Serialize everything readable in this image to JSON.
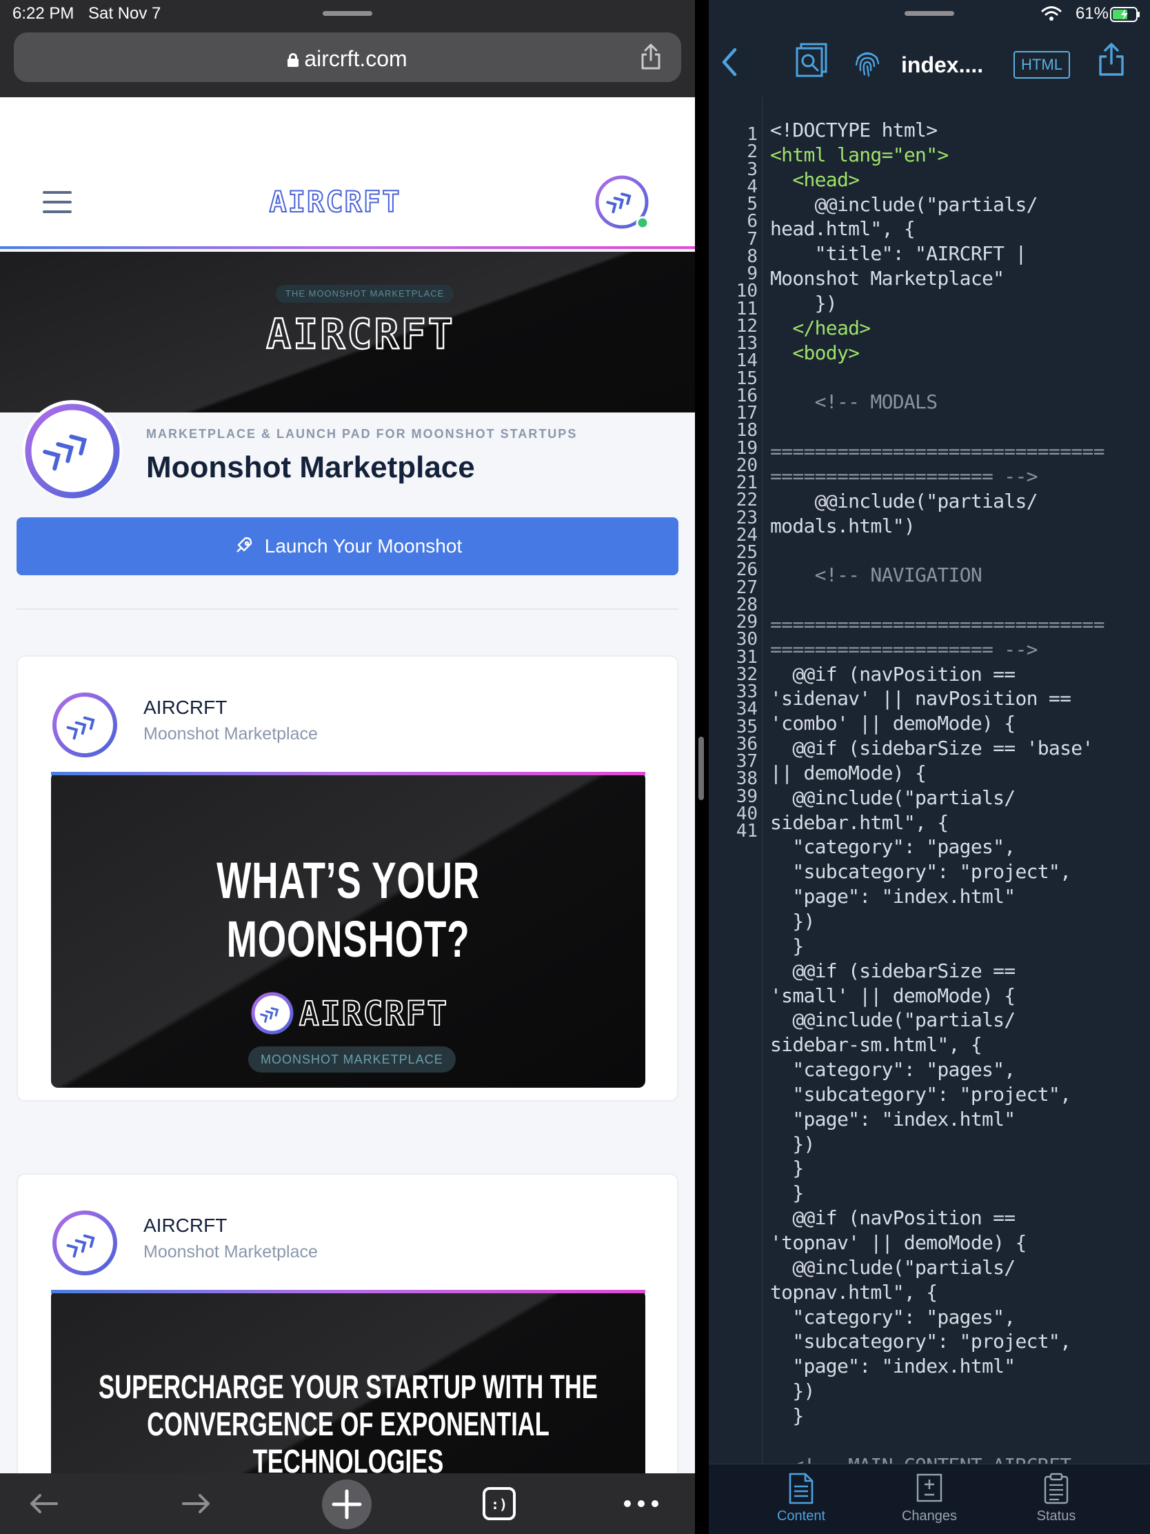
{
  "status_bar": {
    "time": "6:22 PM",
    "date": "Sat Nov 7",
    "battery": "61%"
  },
  "browser": {
    "url": "aircrft.com",
    "site": {
      "logo_text": "AIRCRFT",
      "hero_pill": "THE MOONSHOT MARKETPLACE",
      "hero_logo_text": "AIRCRFT",
      "profile": {
        "eyebrow": "MARKETPLACE & LAUNCH PAD FOR MOONSHOT STARTUPS",
        "title": "Moonshot Marketplace"
      },
      "launch_button": "Launch Your Moonshot",
      "cards": [
        {
          "name": "AIRCRFT",
          "subtitle": "Moonshot Marketplace",
          "headline": "WHAT’S YOUR MOONSHOT?",
          "logo_text": "AIRCRFT",
          "pill": "MOONSHOT MARKETPLACE"
        },
        {
          "name": "AIRCRFT",
          "subtitle": "Moonshot Marketplace",
          "headline_line1": "SUPERCHARGE YOUR STARTUP WITH THE",
          "headline_line2": "CONVERGENCE OF EXPONENTIAL TECHNOLOGIES"
        }
      ]
    },
    "toolbar": [
      "back-arrow-icon",
      "forward-arrow-icon",
      "new-tab-plus-icon",
      "tabs-smiley-icon",
      "more-dots-icon"
    ]
  },
  "editor": {
    "file_title": "index....",
    "language_badge": "HTML",
    "line_numbers": [
      "1",
      "2",
      "3",
      "4",
      "5",
      "6",
      "7",
      "8",
      "9",
      "10",
      "11",
      "12",
      "13",
      "14",
      "15",
      "16",
      "17",
      "18",
      "19",
      "20",
      "21",
      "22",
      "23",
      "24",
      "25",
      "26",
      "27",
      "28",
      "29",
      "30",
      "31",
      "32",
      "33",
      "34",
      "35",
      "36",
      "37",
      "38",
      "39",
      "40",
      "41"
    ],
    "code_lines": [
      {
        "text": "<!DOCTYPE html>",
        "kind": "plain"
      },
      {
        "text": "<html lang=\"en\">",
        "kind": "tag"
      },
      {
        "text": "  <head>",
        "kind": "tag"
      },
      {
        "text": "    @@include(\"partials/",
        "kind": "plain"
      },
      {
        "text": "head.html\", {",
        "kind": "plain"
      },
      {
        "text": "    \"title\": \"AIRCRFT |",
        "kind": "plain"
      },
      {
        "text": "Moonshot Marketplace\"",
        "kind": "plain"
      },
      {
        "text": "    })",
        "kind": "plain"
      },
      {
        "text": "  </head>",
        "kind": "tag"
      },
      {
        "text": "  <body>",
        "kind": "tag"
      },
      {
        "text": "",
        "kind": "plain"
      },
      {
        "text": "    <!-- MODALS",
        "kind": "cm"
      },
      {
        "text": "",
        "kind": "plain"
      },
      {
        "text": "==============================",
        "kind": "cm"
      },
      {
        "text": "==================== -->",
        "kind": "cm"
      },
      {
        "text": "    @@include(\"partials/",
        "kind": "plain"
      },
      {
        "text": "modals.html\")",
        "kind": "plain"
      },
      {
        "text": "",
        "kind": "plain"
      },
      {
        "text": "    <!-- NAVIGATION",
        "kind": "cm"
      },
      {
        "text": "",
        "kind": "plain"
      },
      {
        "text": "==============================",
        "kind": "cm"
      },
      {
        "text": "==================== -->",
        "kind": "cm"
      },
      {
        "text": "  @@if (navPosition ==",
        "kind": "plain"
      },
      {
        "text": "'sidenav' || navPosition ==",
        "kind": "plain"
      },
      {
        "text": "'combo' || demoMode) {",
        "kind": "plain"
      },
      {
        "text": "  @@if (sidebarSize == 'base'",
        "kind": "plain"
      },
      {
        "text": "|| demoMode) {",
        "kind": "plain"
      },
      {
        "text": "  @@include(\"partials/",
        "kind": "plain"
      },
      {
        "text": "sidebar.html\", {",
        "kind": "plain"
      },
      {
        "text": "  \"category\": \"pages\",",
        "kind": "plain"
      },
      {
        "text": "  \"subcategory\": \"project\",",
        "kind": "plain"
      },
      {
        "text": "  \"page\": \"index.html\"",
        "kind": "plain"
      },
      {
        "text": "  })",
        "kind": "plain"
      },
      {
        "text": "  }",
        "kind": "plain"
      },
      {
        "text": "  @@if (sidebarSize ==",
        "kind": "plain"
      },
      {
        "text": "'small' || demoMode) {",
        "kind": "plain"
      },
      {
        "text": "  @@include(\"partials/",
        "kind": "plain"
      },
      {
        "text": "sidebar-sm.html\", {",
        "kind": "plain"
      },
      {
        "text": "  \"category\": \"pages\",",
        "kind": "plain"
      },
      {
        "text": "  \"subcategory\": \"project\",",
        "kind": "plain"
      },
      {
        "text": "  \"page\": \"index.html\"",
        "kind": "plain"
      },
      {
        "text": "  })",
        "kind": "plain"
      },
      {
        "text": "  }",
        "kind": "plain"
      },
      {
        "text": "  }",
        "kind": "plain"
      },
      {
        "text": "  @@if (navPosition ==",
        "kind": "plain"
      },
      {
        "text": "'topnav' || demoMode) {",
        "kind": "plain"
      },
      {
        "text": "  @@include(\"partials/",
        "kind": "plain"
      },
      {
        "text": "topnav.html\", {",
        "kind": "plain"
      },
      {
        "text": "  \"category\": \"pages\",",
        "kind": "plain"
      },
      {
        "text": "  \"subcategory\": \"project\",",
        "kind": "plain"
      },
      {
        "text": "  \"page\": \"index.html\"",
        "kind": "plain"
      },
      {
        "text": "  })",
        "kind": "plain"
      },
      {
        "text": "  }",
        "kind": "plain"
      },
      {
        "text": "",
        "kind": "plain"
      },
      {
        "text": "  <!-- MAIN CONTENT AIRCRFT",
        "kind": "cm"
      }
    ],
    "tabs": [
      {
        "label": "Content",
        "active": true
      },
      {
        "label": "Changes",
        "active": false
      },
      {
        "label": "Status",
        "active": false
      }
    ]
  },
  "colors": {
    "accent_blue": "#4679e3",
    "editor_bg": "#1b2431",
    "tag_green": "#9ee26a",
    "comment_gray": "#8a93a1",
    "link_cyan": "#5ab0e0"
  }
}
